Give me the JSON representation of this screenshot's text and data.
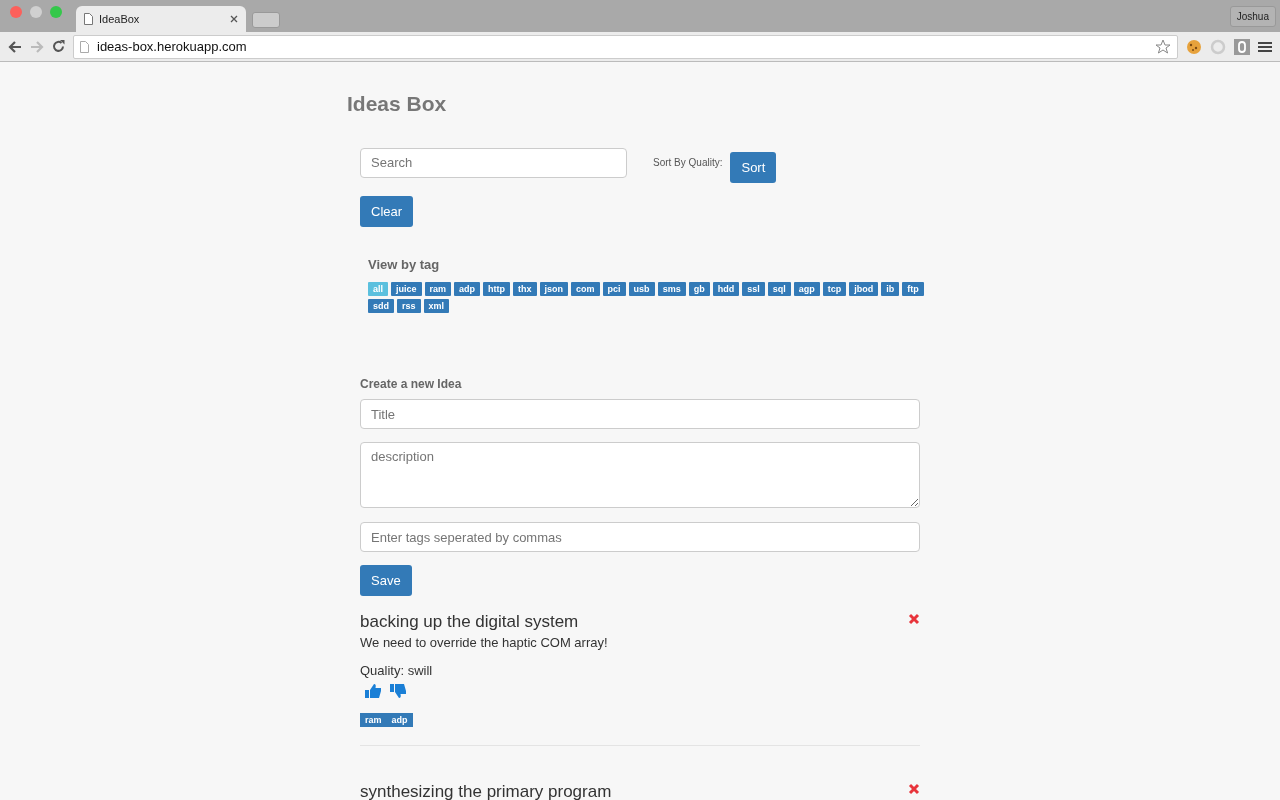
{
  "browser": {
    "tab_title": "IdeaBox",
    "url": "ideas-box.herokuapp.com",
    "profile": "Joshua"
  },
  "title": "Ideas Box",
  "search": {
    "placeholder": "Search"
  },
  "sort": {
    "label": "Sort By Quality:",
    "button": "Sort"
  },
  "clear_button": "Clear",
  "tag_filter": {
    "heading": "View by tag",
    "tags": [
      {
        "label": "all",
        "selected": true
      },
      {
        "label": "juice",
        "selected": false
      },
      {
        "label": "ram",
        "selected": false
      },
      {
        "label": "adp",
        "selected": false
      },
      {
        "label": "http",
        "selected": false
      },
      {
        "label": "thx",
        "selected": false
      },
      {
        "label": "json",
        "selected": false
      },
      {
        "label": "com",
        "selected": false
      },
      {
        "label": "pci",
        "selected": false
      },
      {
        "label": "usb",
        "selected": false
      },
      {
        "label": "sms",
        "selected": false
      },
      {
        "label": "gb",
        "selected": false
      },
      {
        "label": "hdd",
        "selected": false
      },
      {
        "label": "ssl",
        "selected": false
      },
      {
        "label": "sql",
        "selected": false
      },
      {
        "label": "agp",
        "selected": false
      },
      {
        "label": "tcp",
        "selected": false
      },
      {
        "label": "jbod",
        "selected": false
      },
      {
        "label": "ib",
        "selected": false
      },
      {
        "label": "ftp",
        "selected": false
      },
      {
        "label": "sdd",
        "selected": false
      },
      {
        "label": "rss",
        "selected": false
      },
      {
        "label": "xml",
        "selected": false
      }
    ]
  },
  "create": {
    "heading": "Create a new Idea",
    "title_placeholder": "Title",
    "description_placeholder": "description",
    "tags_placeholder": "Enter tags seperated by commas",
    "save_button": "Save"
  },
  "ideas": [
    {
      "title": "backing up the digital system",
      "description": "We need to override the haptic COM array!",
      "quality": "Quality: swill",
      "tags": [
        "ram",
        "adp"
      ]
    },
    {
      "title": "synthesizing the primary program"
    }
  ]
}
